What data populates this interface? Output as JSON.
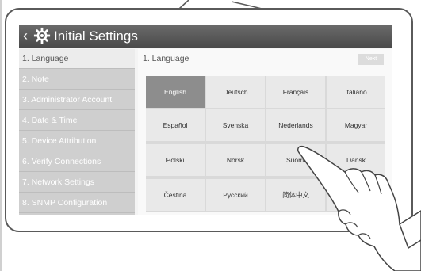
{
  "header": {
    "back_icon": "chevron-left-icon",
    "settings_icon": "gear-icon",
    "title": "Initial Settings"
  },
  "sidebar": {
    "items": [
      {
        "label": "1. Language",
        "active": true
      },
      {
        "label": "2. Note",
        "active": false
      },
      {
        "label": "3. Administrator Account",
        "active": false
      },
      {
        "label": "4. Date & Time",
        "active": false
      },
      {
        "label": "5. Device Attribution",
        "active": false
      },
      {
        "label": "6. Verify Connections",
        "active": false
      },
      {
        "label": "7. Network Settings",
        "active": false
      },
      {
        "label": "8. SNMP Configuration",
        "active": false
      }
    ]
  },
  "main": {
    "title": "1. Language",
    "next_label": "Next",
    "languages": [
      {
        "label": "English",
        "selected": true
      },
      {
        "label": "Deutsch",
        "selected": false
      },
      {
        "label": "Français",
        "selected": false
      },
      {
        "label": "Italiano",
        "selected": false
      },
      {
        "label": "Español",
        "selected": false
      },
      {
        "label": "Svenska",
        "selected": false
      },
      {
        "label": "Nederlands",
        "selected": false
      },
      {
        "label": "Magyar",
        "selected": false
      },
      {
        "label": "Polski",
        "selected": false
      },
      {
        "label": "Norsk",
        "selected": false
      },
      {
        "label": "Suomi",
        "selected": false
      },
      {
        "label": "Dansk",
        "selected": false
      },
      {
        "label": "Čeština",
        "selected": false
      },
      {
        "label": "Русский",
        "selected": false
      },
      {
        "label": "简体中文",
        "selected": false
      },
      {
        "label": "",
        "selected": false
      }
    ]
  },
  "colors": {
    "titlebar": "#555555",
    "selected_cell": "#8d8d8d",
    "sidebar": "#cfcfcf"
  }
}
